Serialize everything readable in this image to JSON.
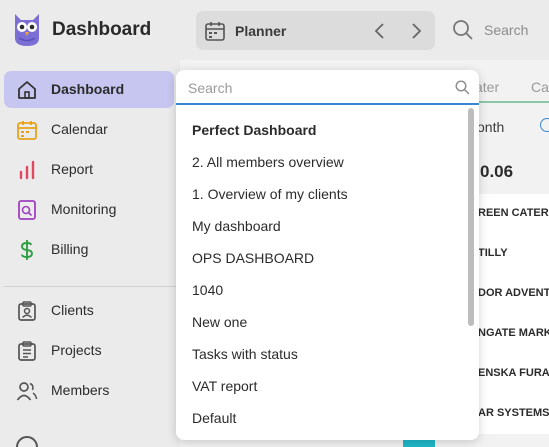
{
  "header": {
    "title": "Dashboard",
    "planner_label": "Planner",
    "search_label": "Search"
  },
  "sidebar": {
    "items": [
      {
        "label": "Dashboard",
        "icon": "home-icon",
        "active": true
      },
      {
        "label": "Calendar",
        "icon": "calendar-icon"
      },
      {
        "label": "Report",
        "icon": "bar-chart-icon"
      },
      {
        "label": "Monitoring",
        "icon": "monitoring-icon"
      },
      {
        "label": "Billing",
        "icon": "dollar-icon"
      },
      {
        "label": "Clients",
        "icon": "clipboard-icon"
      },
      {
        "label": "Projects",
        "icon": "projects-icon"
      },
      {
        "label": "Members",
        "icon": "members-icon"
      }
    ]
  },
  "background": {
    "tab_later": "ater",
    "tab_ca": "Ca",
    "month_text": "onth",
    "big_number": "0.06",
    "client_rows": [
      "REEN CATERI",
      "TILLY",
      "DOR ADVENTU",
      "NGATE MARK",
      "ENSKA FURA",
      "AR SYSTEMS"
    ]
  },
  "dropdown": {
    "search_placeholder": "Search",
    "items": [
      "Perfect Dashboard",
      "2. All members overview",
      "1. Overview of my clients",
      "My dashboard",
      "OPS DASHBOARD",
      "1040",
      "New one",
      "Tasks with status",
      "VAT report",
      "Default"
    ]
  },
  "colors": {
    "accent": "#3a86d6",
    "active_nav": "#c7c6f0",
    "calendar": "#e8a21a",
    "report": "#e0485f",
    "monitoring": "#a03fc0",
    "billing": "#2f9e44",
    "teal": "#1fb8c9"
  }
}
